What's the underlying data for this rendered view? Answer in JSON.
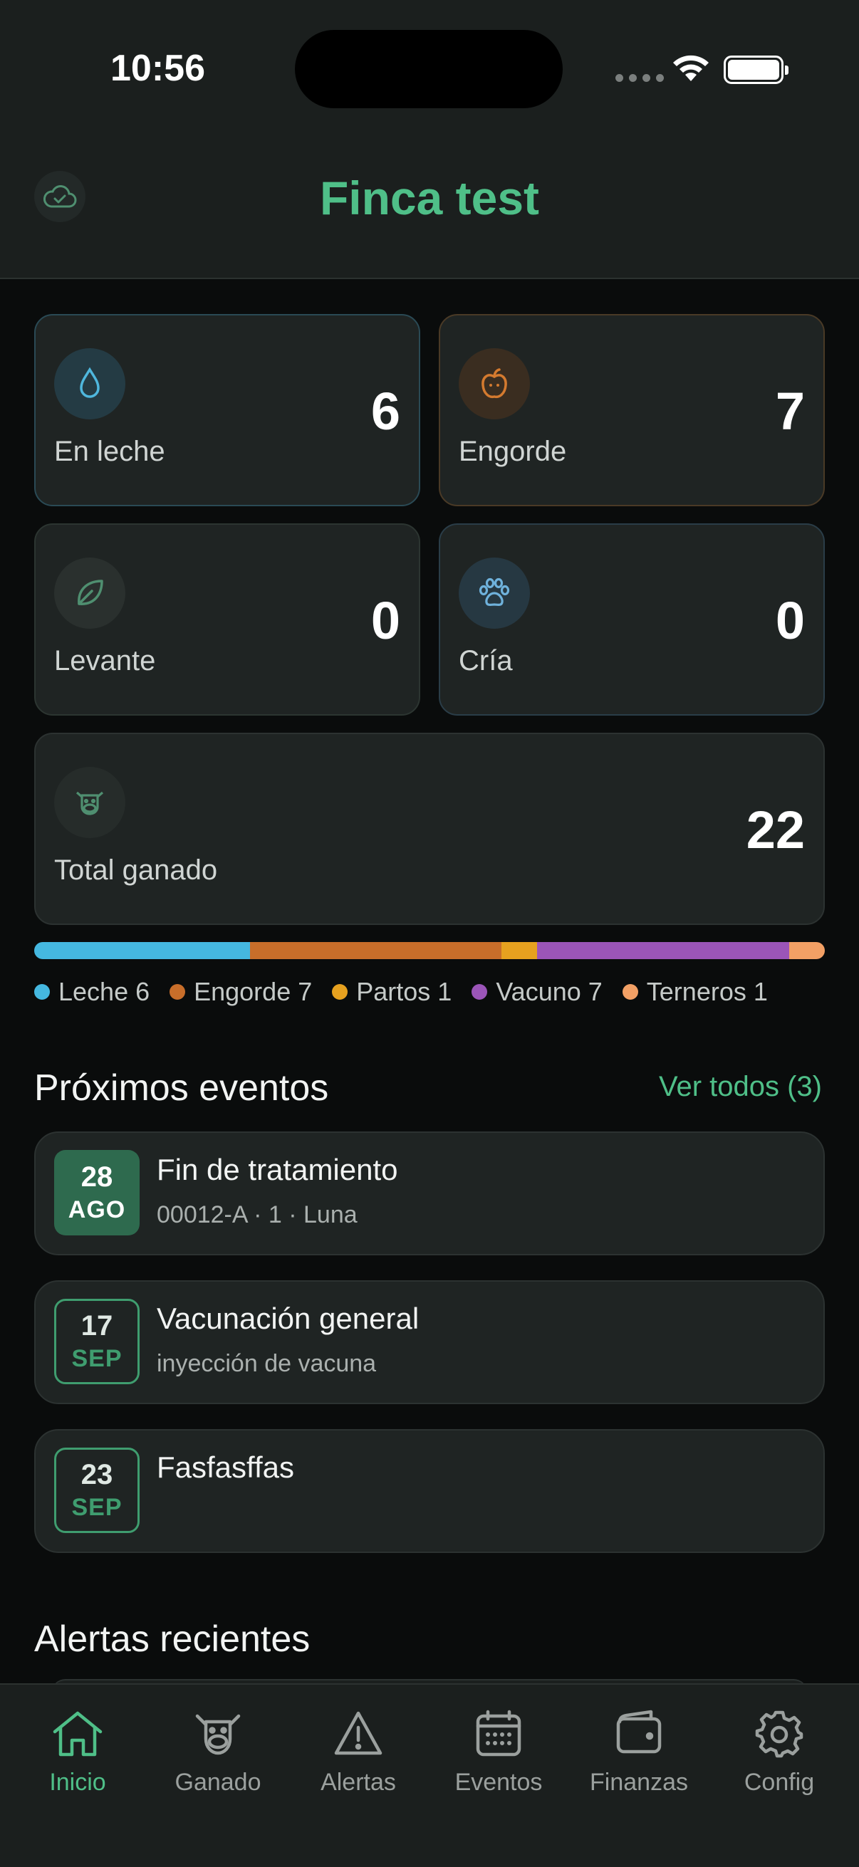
{
  "status_bar": {
    "time": "10:56"
  },
  "header": {
    "title": "Finca test"
  },
  "stats": {
    "milk": {
      "label": "En leche",
      "value": "6"
    },
    "fatten": {
      "label": "Engorde",
      "value": "7"
    },
    "raise": {
      "label": "Levante",
      "value": "0"
    },
    "calf": {
      "label": "Cría",
      "value": "0"
    },
    "total": {
      "label": "Total ganado",
      "value": "22"
    }
  },
  "distribution": {
    "segments": [
      {
        "label": "Leche 6",
        "count": 6,
        "color": "#45b8e0"
      },
      {
        "label": "Engorde 7",
        "count": 7,
        "color": "#c86e2a"
      },
      {
        "label": "Partos 1",
        "count": 1,
        "color": "#e6a11f"
      },
      {
        "label": "Vacuno 7",
        "count": 7,
        "color": "#9b55b8"
      },
      {
        "label": "Terneros 1",
        "count": 1,
        "color": "#f2a065"
      }
    ]
  },
  "events": {
    "title": "Próximos eventos",
    "see_all": "Ver todos (3)",
    "items": [
      {
        "day": "28",
        "month": "AGO",
        "title": "Fin de tratamiento",
        "subtitle": "00012-A · 1 · Luna"
      },
      {
        "day": "17",
        "month": "SEP",
        "title": "Vacunación general",
        "subtitle": "inyección de vacuna"
      },
      {
        "day": "23",
        "month": "SEP",
        "title": "Fasfasffas",
        "subtitle": ""
      }
    ]
  },
  "alerts": {
    "title": "Alertas recientes"
  },
  "tabs": [
    {
      "label": "Inicio",
      "icon": "home-icon",
      "active": true
    },
    {
      "label": "Ganado",
      "icon": "cow-icon",
      "active": false
    },
    {
      "label": "Alertas",
      "icon": "warning-icon",
      "active": false
    },
    {
      "label": "Eventos",
      "icon": "calendar-icon",
      "active": false
    },
    {
      "label": "Finanzas",
      "icon": "wallet-icon",
      "active": false
    },
    {
      "label": "Config",
      "icon": "gear-icon",
      "active": false
    }
  ],
  "colors": {
    "accent": "#4fbf88",
    "background": "#0a0c0c",
    "card": "#1f2423"
  }
}
